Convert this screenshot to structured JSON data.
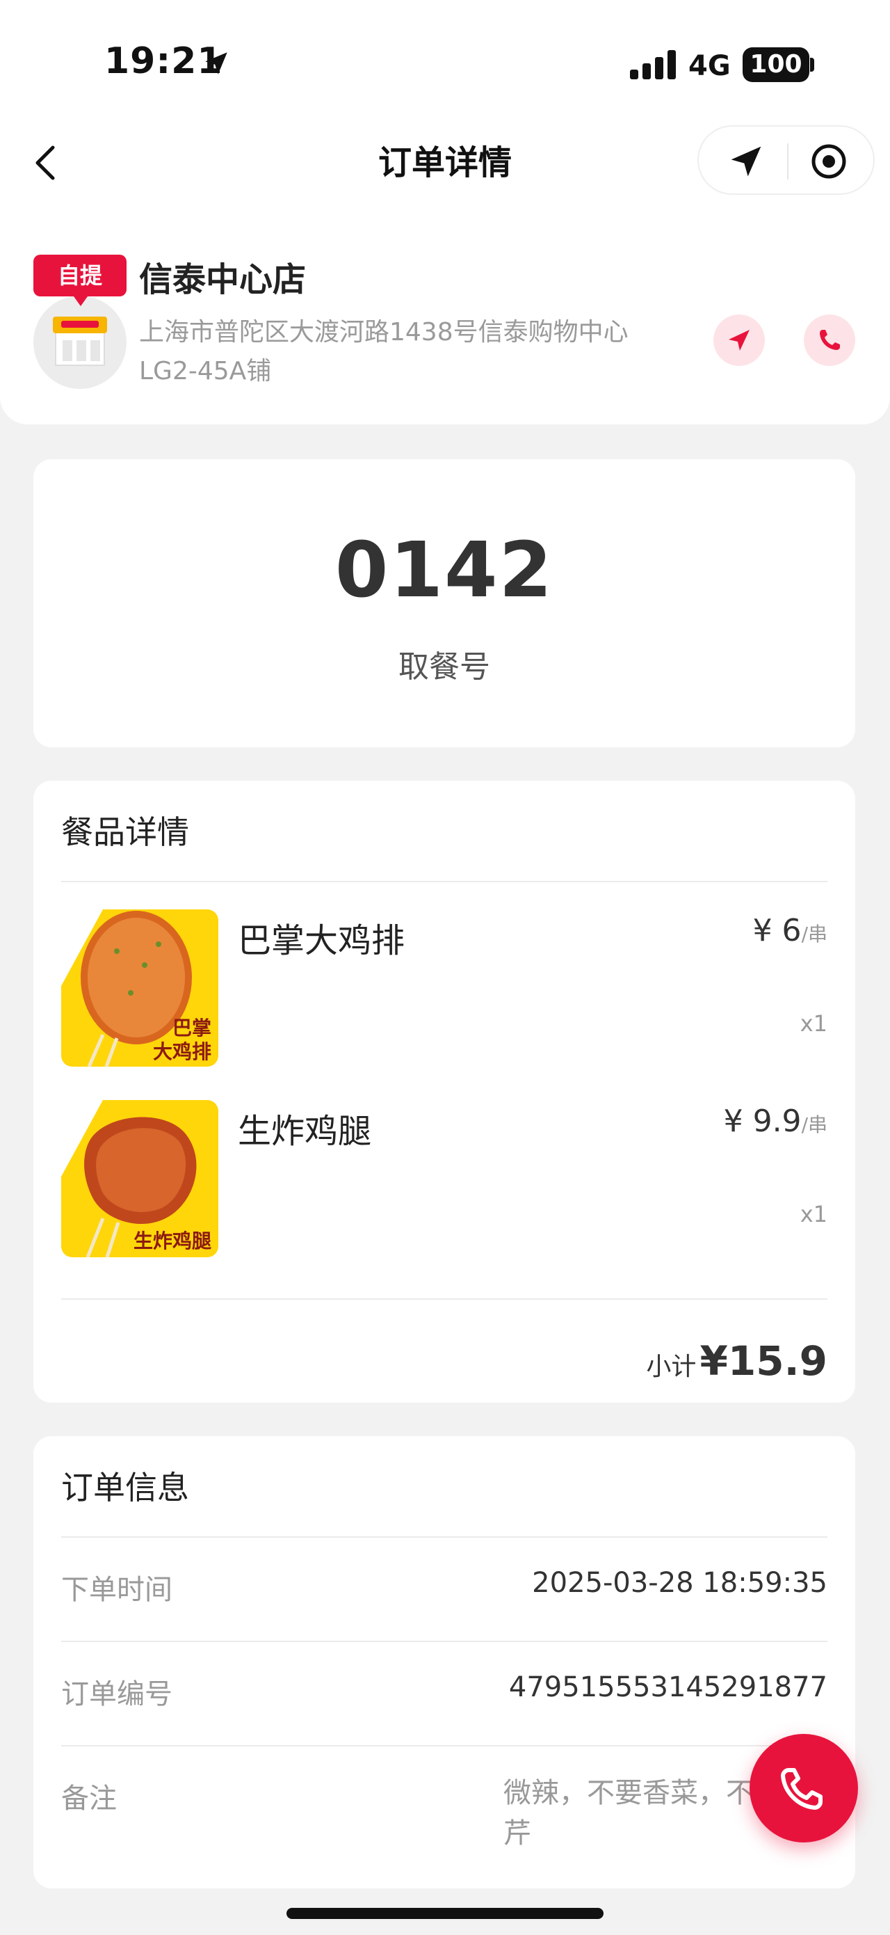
{
  "status_bar": {
    "time": "19:21",
    "network": "4G",
    "battery": "100"
  },
  "nav": {
    "title": "订单详情"
  },
  "store": {
    "tag": "自提",
    "name": "信泰中心店",
    "address_line1": "上海市普陀区大渡河路1438号信泰购物中心",
    "address_line2": "LG2-45A铺"
  },
  "pickup": {
    "number": "0142",
    "label": "取餐号"
  },
  "items_section": {
    "title": "餐品详情",
    "items": [
      {
        "name": "巴掌大鸡排",
        "price": "¥ 6",
        "unit": "/串",
        "qty": "x1",
        "image_caption_1": "巴掌",
        "image_caption_2": "大鸡排"
      },
      {
        "name": "生炸鸡腿",
        "price": "¥ 9.9",
        "unit": "/串",
        "qty": "x1",
        "image_caption_1": "生炸鸡腿"
      }
    ],
    "subtotal_label": "小计",
    "subtotal_value": "¥15.9"
  },
  "order_info": {
    "title": "订单信息",
    "time_label": "下单时间",
    "time_value": "2025-03-28 18:59:35",
    "number_label": "订单编号",
    "number_value": "479515553145291877",
    "remark_label": "备注",
    "remark_value": "微辣，不要香菜，不要芹"
  },
  "colors": {
    "accent": "#e8133c",
    "yellow": "#ffd60a"
  }
}
